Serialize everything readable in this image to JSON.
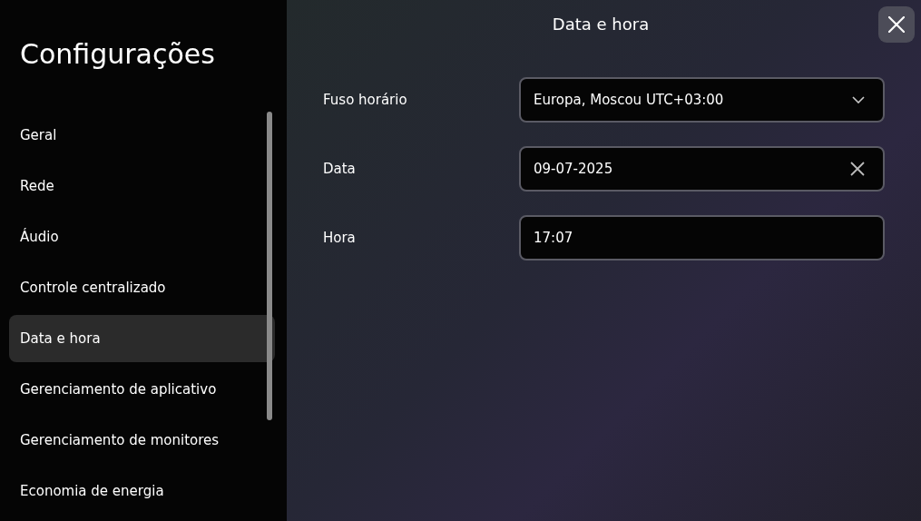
{
  "sidebar": {
    "title": "Configurações",
    "items": [
      {
        "label": "Geral",
        "selected": false
      },
      {
        "label": "Rede",
        "selected": false
      },
      {
        "label": "Áudio",
        "selected": false
      },
      {
        "label": "Controle centralizado",
        "selected": false
      },
      {
        "label": "Data e hora",
        "selected": true
      },
      {
        "label": "Gerenciamento de aplicativo",
        "selected": false
      },
      {
        "label": "Gerenciamento de monitores",
        "selected": false
      },
      {
        "label": "Economia de energia",
        "selected": false
      }
    ]
  },
  "page": {
    "title": "Data e hora",
    "fields": [
      {
        "kind": "select",
        "label": "Fuso horário",
        "value": "Europa, Moscou UTC+03:00"
      },
      {
        "kind": "date",
        "label": "Data",
        "value": "09-07-2025"
      },
      {
        "kind": "text",
        "label": "Hora",
        "value": "17:07"
      }
    ]
  }
}
